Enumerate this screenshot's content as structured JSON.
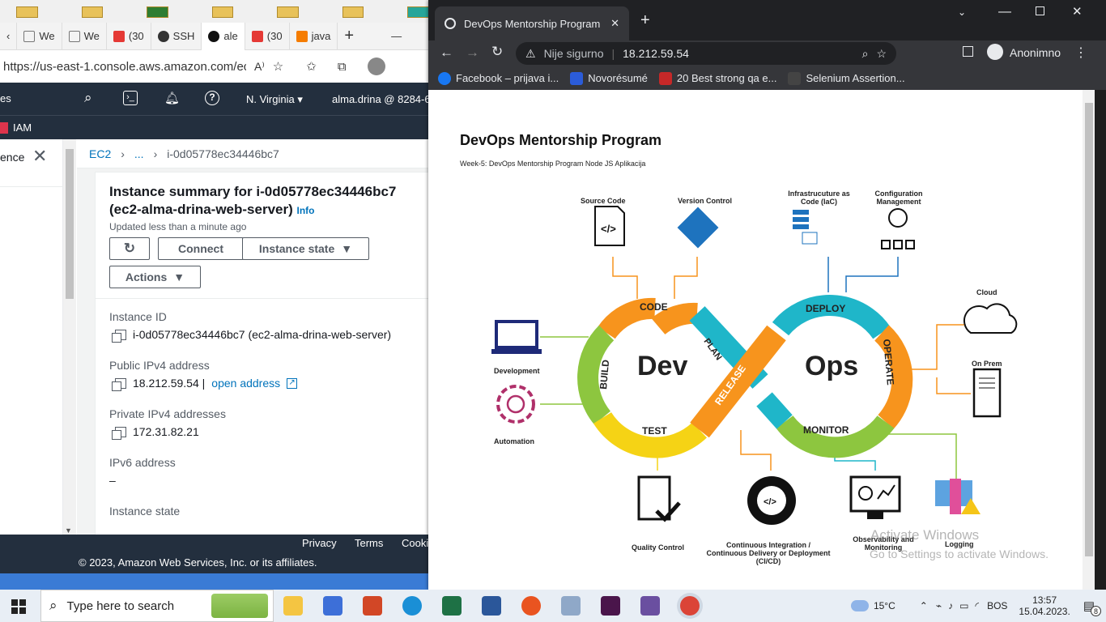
{
  "desktop": {
    "colors": {
      "wallpaper": "#3a7bd5",
      "taskbar": "#e8eef5"
    }
  },
  "edge": {
    "tabs": [
      {
        "label": "We",
        "icon": "page-icon"
      },
      {
        "label": "We",
        "icon": "page-icon"
      },
      {
        "label": "(30",
        "icon": "youtube-icon"
      },
      {
        "label": "SSH",
        "icon": "github-icon"
      },
      {
        "label": "ale",
        "icon": "github-icon"
      },
      {
        "label": "(30",
        "icon": "youtube-icon"
      },
      {
        "label": "java",
        "icon": "java-icon"
      }
    ],
    "address": "https://us-east-1.console.aws.amazon.com/ec..."
  },
  "aws": {
    "nav_services_fragment": "es",
    "region": "N. Virginia",
    "account": "alma.drina @ 8284-6",
    "favorite": "IAM",
    "left_panel_text": "ence",
    "breadcrumb": {
      "root": "EC2",
      "ellipsis": "...",
      "current": "i-0d05778ec34446bc7"
    },
    "summary": {
      "title_line1": "Instance summary for i-0d05778ec34446bc7",
      "title_line2": "(ec2-alma-drina-web-server)",
      "info": "Info",
      "updated": "Updated less than a minute ago",
      "connect": "Connect",
      "instance_state": "Instance state",
      "actions": "Actions"
    },
    "fields": {
      "instance_id_label": "Instance ID",
      "instance_id_value": "i-0d05778ec34446bc7 (ec2-alma-drina-web-server)",
      "public_ipv4_label": "Public IPv4 address",
      "public_ipv4_value": "18.212.59.54 |",
      "open_address": "open address",
      "private_ipv4_label": "Private IPv4 addresses",
      "private_ipv4_value": "172.31.82.21",
      "ipv6_label": "IPv6 address",
      "ipv6_value": "–",
      "instance_state_label": "Instance state"
    },
    "footer": {
      "privacy": "Privacy",
      "terms": "Terms",
      "cookie": "Cooki",
      "copyright": "© 2023, Amazon Web Services, Inc. or its affiliates."
    }
  },
  "chrome": {
    "tab_title": "DevOps Mentorship Program",
    "not_secure": "Nije sigurno",
    "url": "18.212.59.54",
    "profile": "Anonimno",
    "bookmarks": [
      {
        "label": "Facebook – prijava i...",
        "icon": "facebook-icon",
        "color": "#1877f2"
      },
      {
        "label": "Novorésumé",
        "icon": "novoresume-icon",
        "color": "#2b5cd9"
      },
      {
        "label": "20 Best strong qa e...",
        "icon": "s-icon",
        "color": "#c62828"
      },
      {
        "label": "Selenium Assertion...",
        "icon": "selenium-icon",
        "color": "#444444"
      }
    ]
  },
  "page": {
    "title": "DevOps Mentorship Program",
    "subtitle": "Week-5: DevOps Mentorship Program Node JS Aplikacija",
    "diagram": {
      "dev": "Dev",
      "ops": "Ops",
      "stages": {
        "code": "CODE",
        "plan": "PLAN",
        "build": "BUILD",
        "test": "TEST",
        "release": "RELEASE",
        "deploy": "DEPLOY",
        "operate": "OPERATE",
        "monitor": "MONITOR"
      },
      "labels": {
        "source_code": "Source Code",
        "version_control": "Version Control",
        "iac_line1": "Infrastrucuture as",
        "iac_line2": "Code (IaC)",
        "config_line1": "Configuration",
        "config_line2": "Management",
        "cloud": "Cloud",
        "on_prem": "On Prem",
        "development": "Development",
        "automation": "Automation",
        "quality_control": "Quality Control",
        "ci_line1": "Continuous Integration /",
        "ci_line2": "Continuous Delivery or Deployment",
        "ci_line3": "(CI/CD)",
        "observability_line1": "Observability and",
        "observability_line2": "Monitoring",
        "logging": "Logging"
      },
      "colors": {
        "orange": "#f7941d",
        "teal": "#1fb6c9",
        "green": "#8dc63f",
        "yellow": "#f5d315",
        "blue": "#1e73be"
      }
    },
    "watermark_line1": "Activate Windows",
    "watermark_line2": "Go to Settings to activate Windows."
  },
  "taskbar": {
    "search_placeholder": "Type here to search",
    "weather": "15°C",
    "language": "BOS",
    "time": "13:57",
    "date": "15.04.2023.",
    "notifications": "8"
  }
}
